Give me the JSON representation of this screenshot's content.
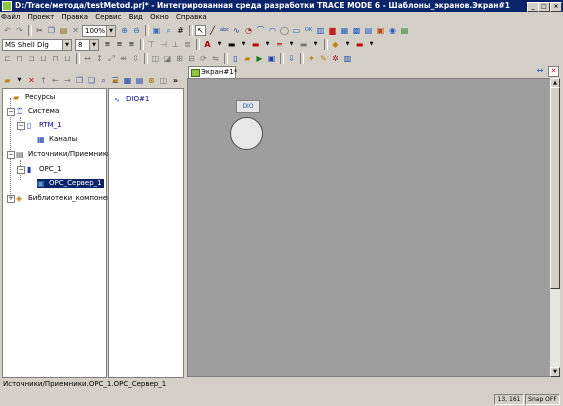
{
  "window": {
    "title": "D:/Trace/метода/testMetod.prj* - Интегрированная среда разработки TRACE MODE 6 - Шаблоны_экранов.Экран#1",
    "minimize": "_",
    "maximize": "□",
    "close": "×"
  },
  "menu": [
    "Файл",
    "Проект",
    "Правка",
    "Сервис",
    "Вид",
    "Окно",
    "Справка"
  ],
  "toolbar": {
    "zoom": "100%",
    "font_name": "MS Shell Dlg",
    "font_size": "8"
  },
  "tree": {
    "items": [
      {
        "label": "Ресурсы",
        "level": 0,
        "icon": "folder-icon"
      },
      {
        "label": "Система",
        "level": 0,
        "icon": "system-icon"
      },
      {
        "label": "RTM_1",
        "level": 1,
        "icon": "node-icon"
      },
      {
        "label": "Каналы",
        "level": 2,
        "icon": "channels-icon"
      },
      {
        "label": "Источники/Приемники",
        "level": 0,
        "icon": "sources-icon"
      },
      {
        "label": "OPC_1",
        "level": 1,
        "icon": "opc-icon"
      },
      {
        "label": "OPC_Сервер_1",
        "level": 2,
        "icon": "server-icon",
        "selected": true
      },
      {
        "label": "Библиотеки_компонентов",
        "level": 0,
        "icon": "library-icon"
      }
    ]
  },
  "mid_panel": {
    "item": "DIO#1"
  },
  "editor": {
    "tab": "Экран#1*",
    "element_label": "DIO"
  },
  "status": {
    "path": "Источники/Приемники.OPC_1.OPC_Сервер_1",
    "coords": "13, 161",
    "snap": "Snap OFF"
  }
}
